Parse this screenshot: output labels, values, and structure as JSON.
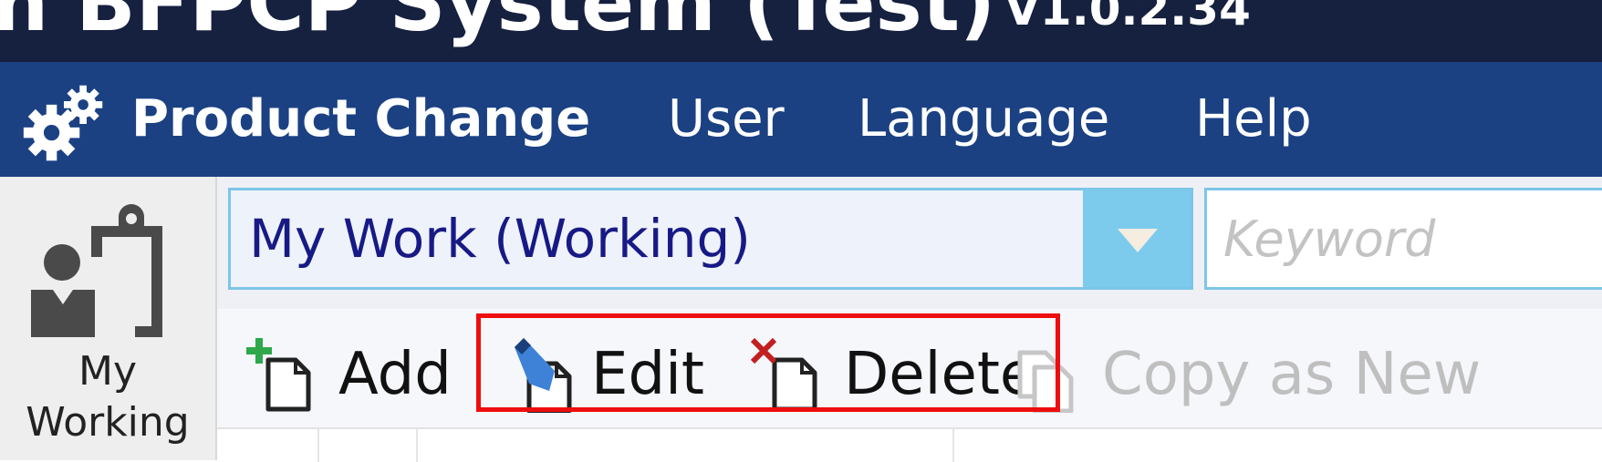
{
  "window": {
    "title": "n BFPCP System (Test)",
    "version": "V1.0.2.34"
  },
  "menubar": {
    "items": [
      {
        "label": "Product Change",
        "icon": "gear-icon",
        "active": true
      },
      {
        "label": "User"
      },
      {
        "label": "Language"
      },
      {
        "label": "Help"
      }
    ]
  },
  "leftnav": {
    "icon": "clipboard-user-icon",
    "label_line1": "My",
    "label_line2": "Working"
  },
  "filter": {
    "selected": "My Work (Working)",
    "search_placeholder": "Keyword"
  },
  "toolbar": {
    "add_label": "Add",
    "edit_label": "Edit",
    "delete_label": "Delete",
    "copy_label": "Copy as New",
    "copy_enabled": false
  },
  "colors": {
    "titlebar": "#16203f",
    "menubar": "#1b4183",
    "accent": "#7cc6e8",
    "highlight": "#ee0d0d"
  }
}
